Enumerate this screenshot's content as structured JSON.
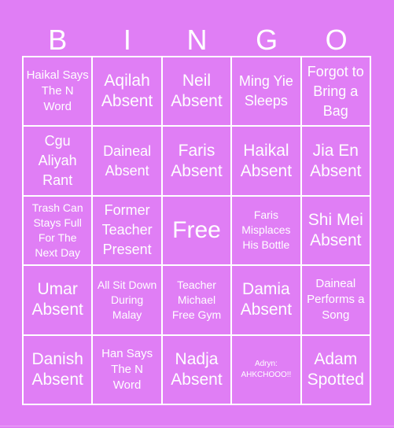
{
  "header": [
    "B",
    "I",
    "N",
    "G",
    "O"
  ],
  "colors": {
    "background": "#e07ef5",
    "text": "#ffffff",
    "lines": "#ffffff"
  },
  "cells": [
    [
      "Haikal Says The N Word",
      "Aqilah Absent",
      "Neil Absent",
      "Ming Yie Sleeps",
      "Forgot to Bring a Bag"
    ],
    [
      "Cgu Aliyah Rant",
      "Daineal Absent",
      "Faris Absent",
      "Haikal Absent",
      "Jia En Absent"
    ],
    [
      "Trash Can Stays Full For The Next Day",
      "Former Teacher Present",
      "Free",
      "Faris Misplaces His Bottle",
      "Shi Mei Absent"
    ],
    [
      "Umar Absent",
      "All Sit Down During Malay",
      "Teacher Michael Free Gym",
      "Damia Absent",
      "Daineal Performs a Song"
    ],
    [
      "Danish Absent",
      "Han Says The N Word",
      "Nadja Absent",
      "Adryn: AHKCHOOO!!",
      "Adam Spotted"
    ]
  ]
}
